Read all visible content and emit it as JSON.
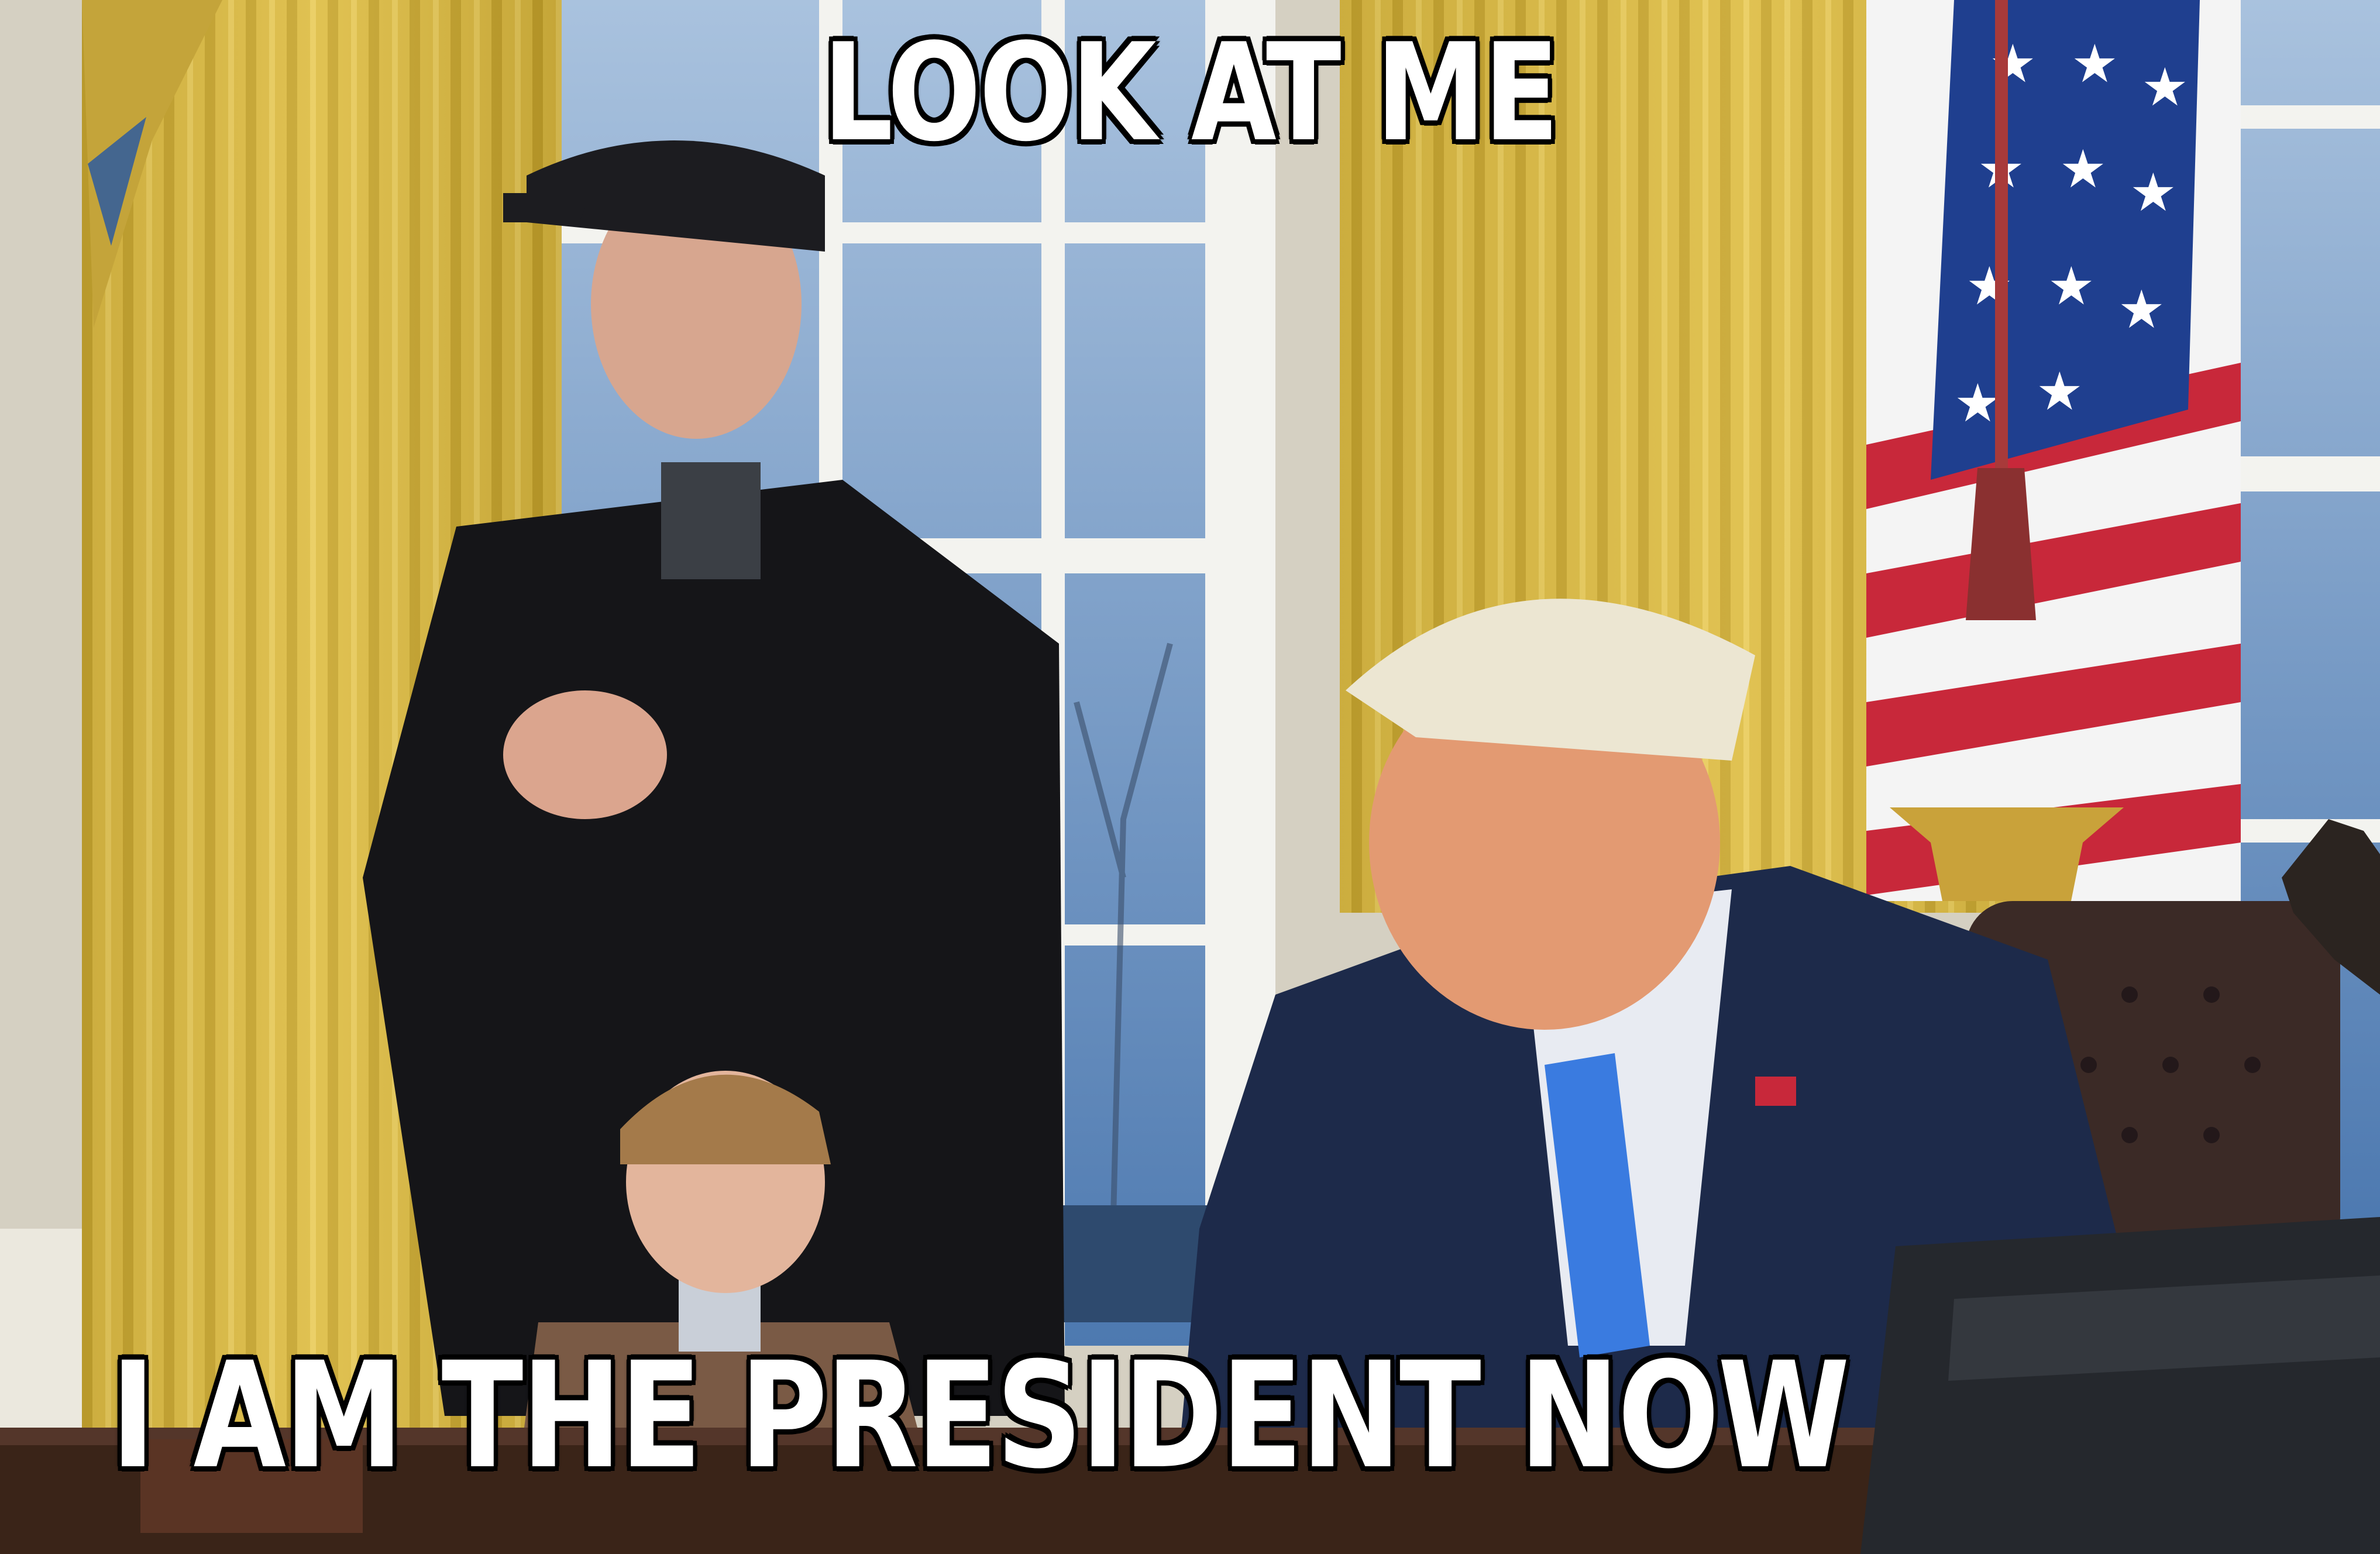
{
  "meme": {
    "top_text": "LOOK AT ME",
    "bottom_text": "I AM THE PRESIDENT NOW"
  },
  "colors": {
    "curtain": "#d9b94a",
    "curtain_shadow": "#9c7f22",
    "window_sky": "#6f98c8",
    "window_frame": "#f2f2ee",
    "wall": "#d8d4c6",
    "coat_black": "#151518",
    "suit_navy": "#1d2a4a",
    "tie_blue": "#3a7be0",
    "flag_red": "#c8283a",
    "flag_blue": "#1f3f8f",
    "desk_wood": "#3a2418",
    "chair_leather": "#3b2a26"
  }
}
